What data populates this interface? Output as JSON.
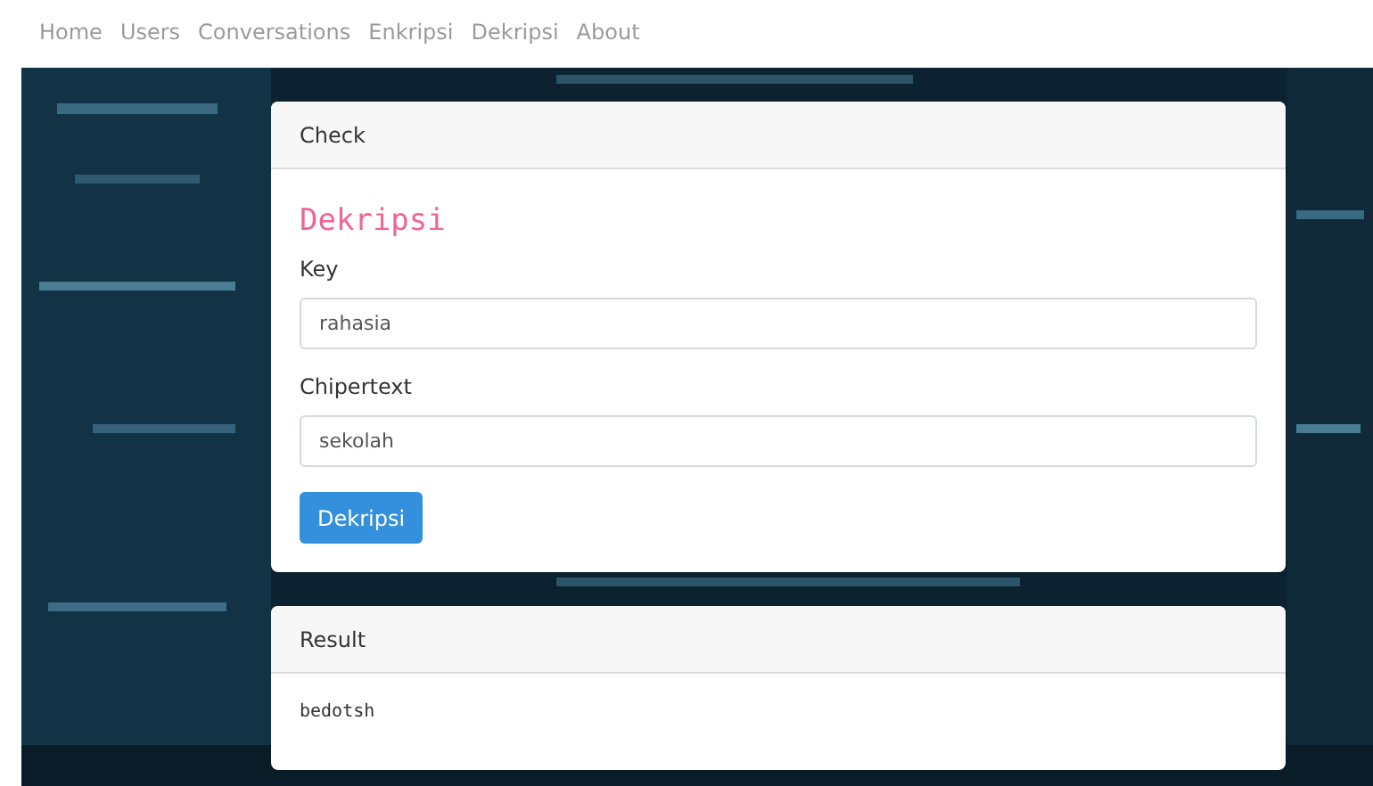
{
  "nav": {
    "items": [
      "Home",
      "Users",
      "Conversations",
      "Enkripsi",
      "Dekripsi",
      "About"
    ]
  },
  "check_card": {
    "header": "Check",
    "heading": "Dekripsi",
    "fields": [
      {
        "label": "Key",
        "value": "rahasia"
      },
      {
        "label": "Chipertext",
        "value": "sekolah"
      }
    ],
    "button": "Dekripsi"
  },
  "result_card": {
    "header": "Result",
    "output": "bedotsh"
  }
}
